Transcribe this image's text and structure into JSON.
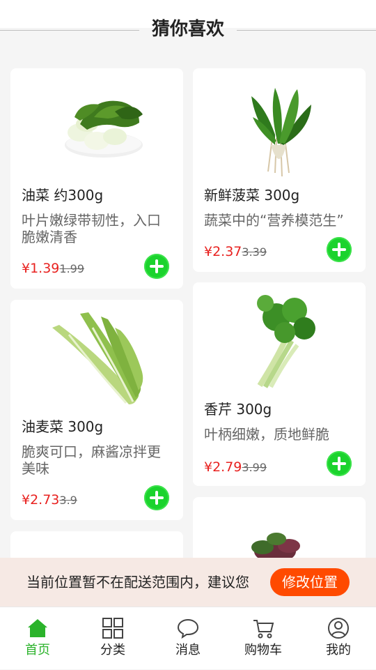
{
  "section": {
    "title": "猜你喜欢"
  },
  "products": [
    {
      "name": "油菜 约300g",
      "desc": "叶片嫩绿带韧性，入口脆嫩清香",
      "price": "¥1.39",
      "orig": "1.99"
    },
    {
      "name": "新鲜菠菜 300g",
      "desc": "蔬菜中的“营养模范生”",
      "price": "¥2.37",
      "orig": "3.39"
    },
    {
      "name": "油麦菜 300g",
      "desc": "脆爽可口，麻酱凉拌更美味",
      "price": "¥2.73",
      "orig": "3.9"
    },
    {
      "name": "香芹 300g",
      "desc": "叶柄细嫩，质地鲜脆",
      "price": "¥2.79",
      "orig": "3.99"
    }
  ],
  "notice": {
    "message": "当前位置暂不在配送范围内，建议您",
    "button": "修改位置"
  },
  "tabbar": {
    "items": [
      {
        "label": "首页",
        "icon": "home-icon",
        "active": true
      },
      {
        "label": "分类",
        "icon": "grid-icon"
      },
      {
        "label": "消息",
        "icon": "chat-bubble-icon"
      },
      {
        "label": "购物车",
        "icon": "cart-icon"
      },
      {
        "label": "我的",
        "icon": "user-icon"
      }
    ]
  },
  "colors": {
    "accent": "#2bb32b",
    "price": "#e8211f",
    "add_button": "#1bd32d",
    "notice_button": "#ff4a00"
  }
}
